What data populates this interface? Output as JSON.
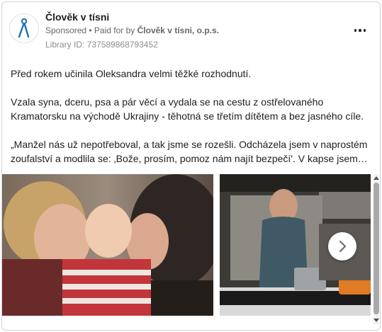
{
  "post": {
    "page_name": "Člověk v tísni",
    "sponsored_label": "Sponsored",
    "paid_prefix": "• Paid for by ",
    "paid_by": "Člověk v tísni, o.p.s.",
    "library_id": "Library ID: 737589868793452"
  },
  "body": {
    "paragraphs": [
      "Před rokem učinila Oleksandra velmi těžké rozhodnutí.",
      "Vzala syna, dceru, psa a pár věcí a vydala se na cestu z ostřelovaného Kramatorsku na východě Ukrajiny - těhotná se třetím dítětem a bez jasného cíle.",
      "„Manžel nás už nepotřeboval, a tak jsme se rozešli. Odcházela jsem v naprostém zoufalství a modlila se: ‚Bože, prosím, pomoz nám najít bezpečí'. V kapse jsem…"
    ]
  },
  "icons": {
    "avatar": "clovek-v-tisni-logo-icon",
    "more": "more-options-icon",
    "next": "chevron-right-icon",
    "scroll_up": "scroll-up-arrow-icon",
    "scroll_down": "scroll-down-arrow-icon"
  },
  "colors": {
    "brand": "#1f6fb2",
    "secondary_text": "#65676b"
  }
}
